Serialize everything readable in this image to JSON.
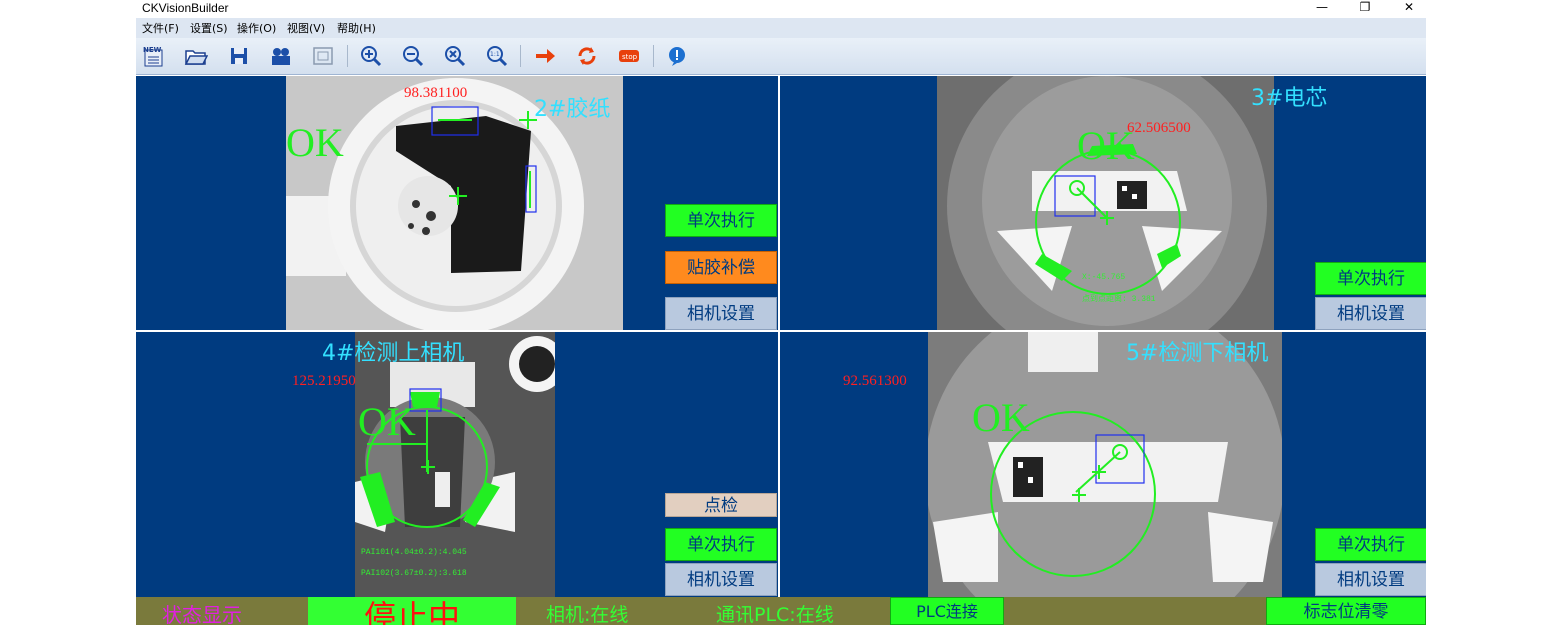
{
  "window": {
    "title": "CKVisionBuilder",
    "minimize": "—",
    "maximize": "❐",
    "close": "✕"
  },
  "menu": {
    "items": [
      "文件(F)",
      "设置(S)",
      "操作(O)",
      "视图(V)",
      "帮助(H)"
    ]
  },
  "toolbar": {
    "icons": [
      "new-icon",
      "open-folder-icon",
      "save-icon",
      "users-icon",
      "fit-window-icon",
      "zoom-in-icon",
      "zoom-out-icon",
      "zoom-reset-icon",
      "zoom-actual-icon",
      "run-arrow-icon",
      "loop-icon",
      "stop-icon",
      "help-icon"
    ],
    "new_text": "NEW",
    "stop_text": "stop",
    "actual_text": "1:1"
  },
  "panels": {
    "p2": {
      "title": "2#胶纸",
      "value": "98.381100",
      "result": "OK",
      "buttons": {
        "run_once": "单次执行",
        "tape_comp": "贴胶补偿",
        "camera_settings": "相机设置"
      }
    },
    "p3": {
      "title": "3#电芯",
      "value": "62.506500",
      "result": "OK",
      "info_x": "X:-45.765",
      "info_dist": "点到点距离: 3.381",
      "buttons": {
        "run_once": "单次执行",
        "camera_settings": "相机设置"
      }
    },
    "p4": {
      "title": "4#检测上相机",
      "value": "125.21950",
      "result": "OK",
      "measure1": "PAI101(4.04±0.2):4.045",
      "measure2": "PAI102(3.67±0.2):3.618",
      "buttons": {
        "spot_check": "点检",
        "run_once": "单次执行",
        "camera_settings": "相机设置"
      }
    },
    "p5": {
      "title": "5#检测下相机",
      "value": "92.561300",
      "result": "OK",
      "buttons": {
        "run_once": "单次执行",
        "camera_settings": "相机设置"
      }
    }
  },
  "status": {
    "display_label": "状态显示",
    "state": "停止中",
    "camera_status": "相机:在线",
    "plc_status": "通讯PLC:在线",
    "plc_connect": "PLC连接",
    "clear_flags": "标志位清零"
  },
  "colors": {
    "panel_bg": "#003b80",
    "accent_green": "#22ff22",
    "status_bg": "#7a7a3c",
    "title_cyan": "#33e0ff",
    "value_red": "#ff2020"
  }
}
